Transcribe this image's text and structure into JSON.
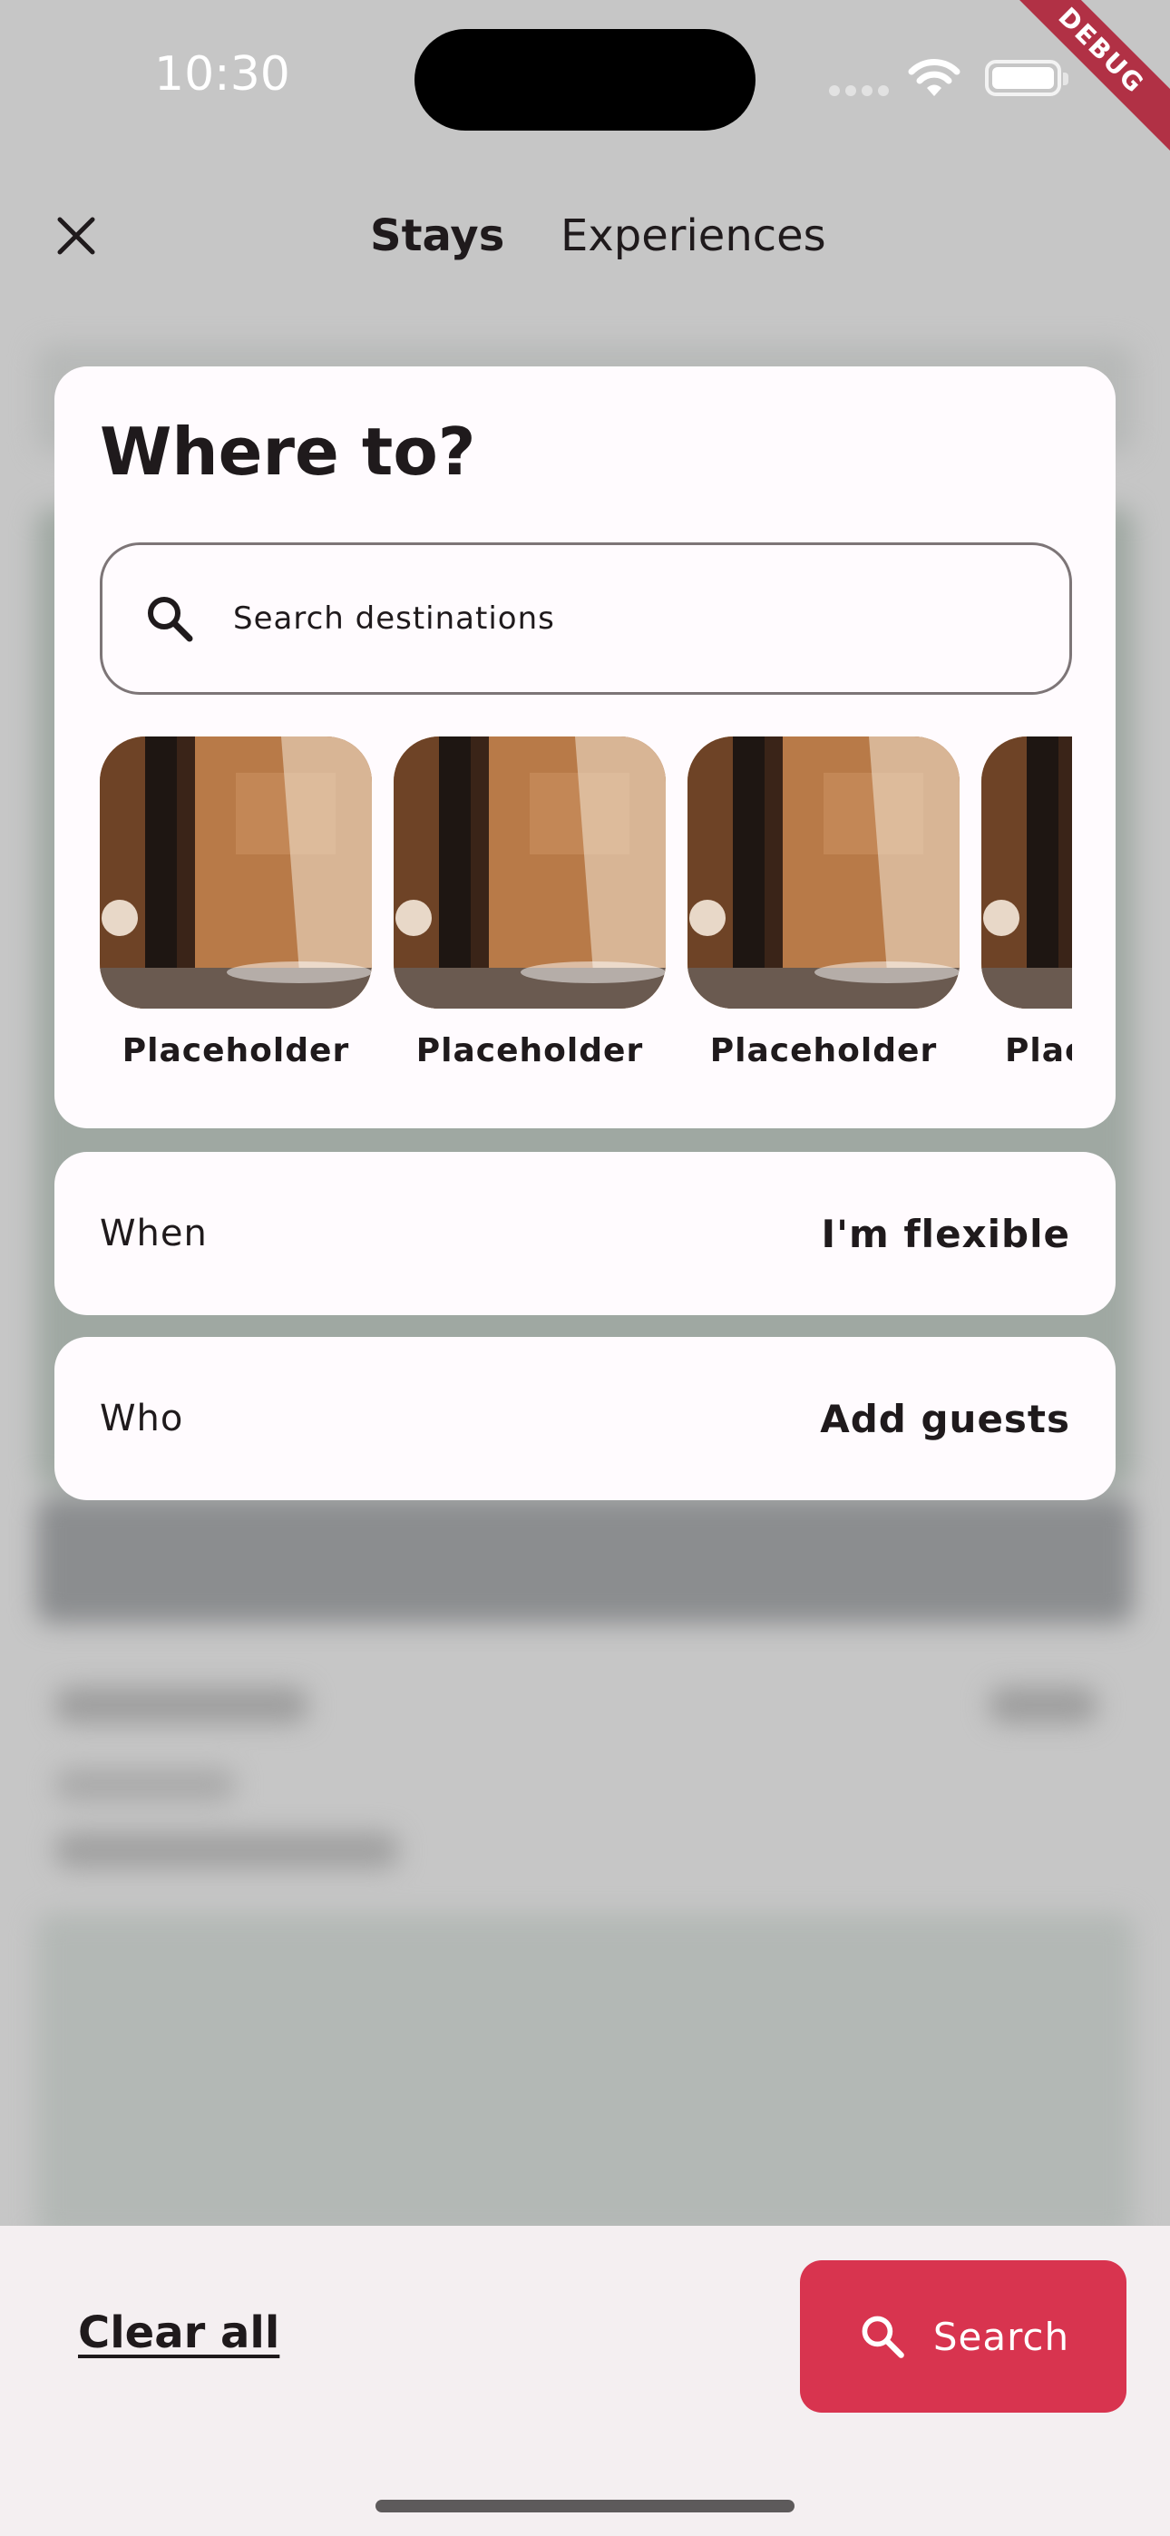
{
  "status_bar": {
    "time": "10:30"
  },
  "debug_banner": "DEBUG",
  "nav": {
    "tabs": [
      {
        "label": "Stays",
        "active": true
      },
      {
        "label": "Experiences",
        "active": false
      }
    ]
  },
  "where": {
    "title": "Where to?",
    "search_placeholder": "Search destinations",
    "destinations": [
      {
        "label": "Placeholder"
      },
      {
        "label": "Placeholder"
      },
      {
        "label": "Placeholder"
      },
      {
        "label": "Placeholder"
      }
    ]
  },
  "when": {
    "label": "When",
    "value": "I'm flexible"
  },
  "who": {
    "label": "Who",
    "value": "Add guests"
  },
  "footer": {
    "clear_label": "Clear all",
    "search_label": "Search"
  },
  "colors": {
    "accent": "#d8344f",
    "card": "#fffbfe",
    "scrim": "#c6c6c6"
  }
}
